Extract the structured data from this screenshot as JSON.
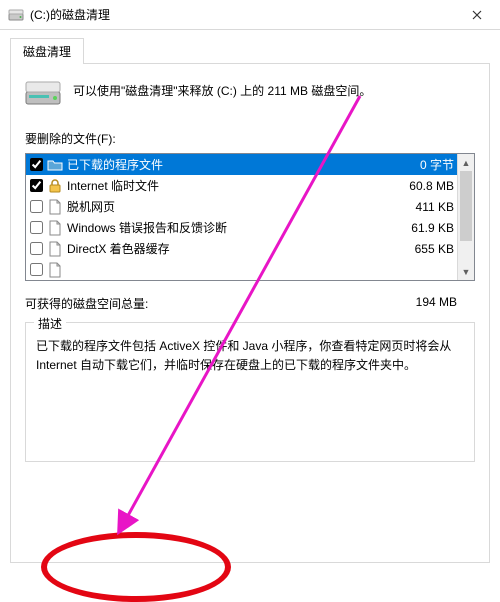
{
  "window": {
    "title": "(C:)的磁盘清理"
  },
  "tab": {
    "label": "磁盘清理"
  },
  "intro": "可以使用\"磁盘清理\"来释放  (C:) 上的 211 MB 磁盘空间。",
  "delete_label": "要删除的文件(F):",
  "files": [
    {
      "checked": true,
      "label": "已下载的程序文件",
      "size": "0 字节",
      "selected": true,
      "icon": "folder"
    },
    {
      "checked": true,
      "label": "Internet 临时文件",
      "size": "60.8 MB",
      "selected": false,
      "icon": "lock"
    },
    {
      "checked": false,
      "label": "脱机网页",
      "size": "411 KB",
      "selected": false,
      "icon": "page"
    },
    {
      "checked": false,
      "label": "Windows 错误报告和反馈诊断",
      "size": "61.9 KB",
      "selected": false,
      "icon": "page"
    },
    {
      "checked": false,
      "label": "DirectX 着色器缓存",
      "size": "655 KB",
      "selected": false,
      "icon": "page"
    },
    {
      "checked": false,
      "label": "",
      "size": "",
      "selected": false,
      "icon": "page"
    }
  ],
  "total": {
    "label": "可获得的磁盘空间总量:",
    "value": "194 MB"
  },
  "description": {
    "legend": "描述",
    "text": "已下载的程序文件包括 ActiveX 控件和 Java 小程序，你查看特定网页时将会从 Internet 自动下载它们，并临时保存在硬盘上的已下载的程序文件夹中。"
  }
}
